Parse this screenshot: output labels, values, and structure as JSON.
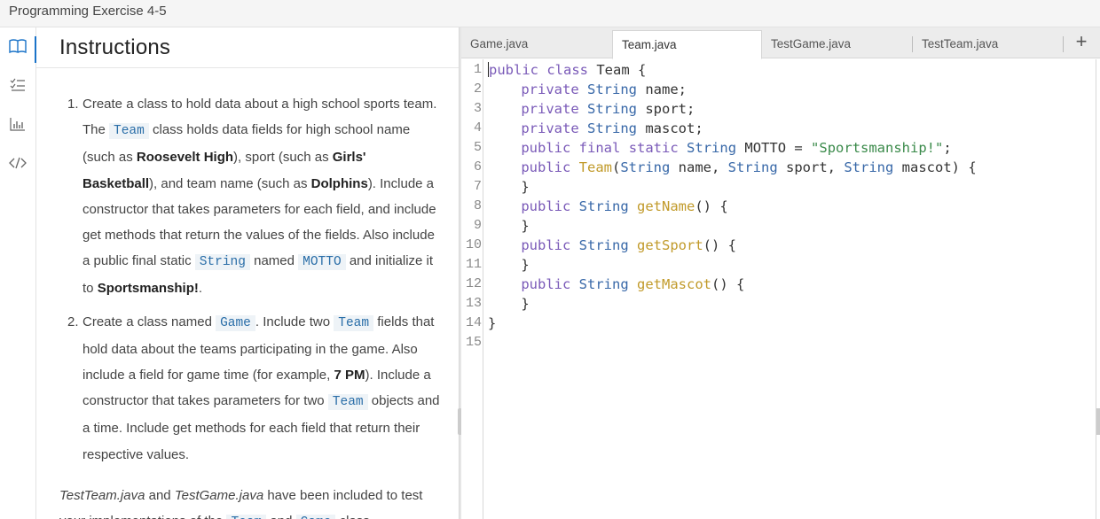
{
  "window": {
    "title": "Programming Exercise 4-5"
  },
  "rail": {
    "icons": [
      "book-icon",
      "checklist-icon",
      "chart-icon",
      "code-icon"
    ],
    "active": "book-icon"
  },
  "instructions": {
    "heading": "Instructions",
    "items": [
      {
        "num": "1.",
        "parts": [
          {
            "t": "text",
            "v": "Create a class to hold data about a high school sports team. The "
          },
          {
            "t": "code",
            "v": "Team"
          },
          {
            "t": "text",
            "v": " class holds data fields for high school name (such as "
          },
          {
            "t": "bold",
            "v": "Roosevelt High"
          },
          {
            "t": "text",
            "v": "), sport (such as "
          },
          {
            "t": "bold",
            "v": "Girls' Basketball"
          },
          {
            "t": "text",
            "v": "), and team name (such as "
          },
          {
            "t": "bold",
            "v": "Dolphins"
          },
          {
            "t": "text",
            "v": "). Include a constructor that takes parameters for each field, and include get methods that return the values of the fields. Also include a public final static "
          },
          {
            "t": "code",
            "v": "String"
          },
          {
            "t": "text",
            "v": " named "
          },
          {
            "t": "code",
            "v": "MOTTO"
          },
          {
            "t": "text",
            "v": " and initialize it to "
          },
          {
            "t": "bold",
            "v": "Sportsmanship!"
          },
          {
            "t": "text",
            "v": "."
          }
        ]
      },
      {
        "num": "2.",
        "parts": [
          {
            "t": "text",
            "v": "Create a class named "
          },
          {
            "t": "code",
            "v": "Game"
          },
          {
            "t": "text",
            "v": ". Include two "
          },
          {
            "t": "code",
            "v": "Team"
          },
          {
            "t": "text",
            "v": " fields that hold data about the teams participating in the game. Also include a field for game time (for example, "
          },
          {
            "t": "bold",
            "v": "7 PM"
          },
          {
            "t": "text",
            "v": "). Include a constructor that takes parameters for two "
          },
          {
            "t": "code",
            "v": "Team"
          },
          {
            "t": "text",
            "v": " objects and a time. Include get methods for each field that return their respective values."
          }
        ]
      }
    ],
    "note": [
      {
        "t": "ital",
        "v": "TestTeam.java"
      },
      {
        "t": "text",
        "v": " and "
      },
      {
        "t": "ital",
        "v": "TestGame.java"
      },
      {
        "t": "text",
        "v": " have been included to test your implementations of the "
      },
      {
        "t": "code",
        "v": "Team"
      },
      {
        "t": "text",
        "v": " and "
      },
      {
        "t": "code",
        "v": "Game"
      },
      {
        "t": "text",
        "v": " class"
      }
    ]
  },
  "editor": {
    "tabs": [
      "Game.java",
      "Team.java",
      "TestGame.java",
      "TestTeam.java"
    ],
    "active_tab": "Team.java",
    "add_tab_label": "+",
    "line_numbers": [
      "1",
      "2",
      "3",
      "4",
      "5",
      "6",
      "7",
      "8",
      "9",
      "10",
      "11",
      "12",
      "13",
      "14",
      "15"
    ],
    "lines": [
      [
        {
          "c": "kw",
          "v": "public"
        },
        {
          "c": "",
          "v": " "
        },
        {
          "c": "kw",
          "v": "class"
        },
        {
          "c": "",
          "v": " Team {"
        }
      ],
      [
        {
          "c": "",
          "v": "    "
        },
        {
          "c": "kw",
          "v": "private"
        },
        {
          "c": "",
          "v": " "
        },
        {
          "c": "ty",
          "v": "String"
        },
        {
          "c": "",
          "v": " name;"
        }
      ],
      [
        {
          "c": "",
          "v": "    "
        },
        {
          "c": "kw",
          "v": "private"
        },
        {
          "c": "",
          "v": " "
        },
        {
          "c": "ty",
          "v": "String"
        },
        {
          "c": "",
          "v": " sport;"
        }
      ],
      [
        {
          "c": "",
          "v": "    "
        },
        {
          "c": "kw",
          "v": "private"
        },
        {
          "c": "",
          "v": " "
        },
        {
          "c": "ty",
          "v": "String"
        },
        {
          "c": "",
          "v": " mascot;"
        }
      ],
      [
        {
          "c": "",
          "v": "    "
        },
        {
          "c": "kw",
          "v": "public"
        },
        {
          "c": "",
          "v": " "
        },
        {
          "c": "kw",
          "v": "final"
        },
        {
          "c": "",
          "v": " "
        },
        {
          "c": "kw",
          "v": "static"
        },
        {
          "c": "",
          "v": " "
        },
        {
          "c": "ty",
          "v": "String"
        },
        {
          "c": "",
          "v": " MOTTO = "
        },
        {
          "c": "st",
          "v": "\"Sportsmanship!\""
        },
        {
          "c": "",
          "v": ";"
        }
      ],
      [
        {
          "c": "",
          "v": "    "
        },
        {
          "c": "kw",
          "v": "public"
        },
        {
          "c": "",
          "v": " "
        },
        {
          "c": "fn",
          "v": "Team"
        },
        {
          "c": "",
          "v": "("
        },
        {
          "c": "ty",
          "v": "String"
        },
        {
          "c": "",
          "v": " name, "
        },
        {
          "c": "ty",
          "v": "String"
        },
        {
          "c": "",
          "v": " sport, "
        },
        {
          "c": "ty",
          "v": "String"
        },
        {
          "c": "",
          "v": " mascot) {"
        }
      ],
      [
        {
          "c": "",
          "v": "    }"
        }
      ],
      [
        {
          "c": "",
          "v": "    "
        },
        {
          "c": "kw",
          "v": "public"
        },
        {
          "c": "",
          "v": " "
        },
        {
          "c": "ty",
          "v": "String"
        },
        {
          "c": "",
          "v": " "
        },
        {
          "c": "fn",
          "v": "getName"
        },
        {
          "c": "",
          "v": "() {"
        }
      ],
      [
        {
          "c": "",
          "v": "    }"
        }
      ],
      [
        {
          "c": "",
          "v": "    "
        },
        {
          "c": "kw",
          "v": "public"
        },
        {
          "c": "",
          "v": " "
        },
        {
          "c": "ty",
          "v": "String"
        },
        {
          "c": "",
          "v": " "
        },
        {
          "c": "fn",
          "v": "getSport"
        },
        {
          "c": "",
          "v": "() {"
        }
      ],
      [
        {
          "c": "",
          "v": "    }"
        }
      ],
      [
        {
          "c": "",
          "v": "    "
        },
        {
          "c": "kw",
          "v": "public"
        },
        {
          "c": "",
          "v": " "
        },
        {
          "c": "ty",
          "v": "String"
        },
        {
          "c": "",
          "v": " "
        },
        {
          "c": "fn",
          "v": "getMascot"
        },
        {
          "c": "",
          "v": "() {"
        }
      ],
      [
        {
          "c": "",
          "v": "    }"
        }
      ],
      [
        {
          "c": "",
          "v": "}"
        }
      ],
      [
        {
          "c": "",
          "v": ""
        }
      ]
    ]
  },
  "colors": {
    "keyword": "#7a5ab8",
    "type": "#3868a8",
    "method": "#c19a2a",
    "string": "#3a8a4a",
    "accent": "#1a73c8"
  }
}
